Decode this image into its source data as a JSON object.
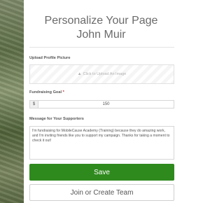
{
  "header": {
    "title_line1": "Personalize Your Page",
    "title_line2": "John Muir"
  },
  "upload": {
    "label": "Upload Profile Picture",
    "button_text": "Click to Upload An Image",
    "icon": "upload-icon"
  },
  "goal": {
    "label": "Fundraising Goal",
    "required_marker": "*",
    "currency": "$",
    "value": "150"
  },
  "message": {
    "label": "Message for Your Supporters",
    "value": "I'm fundraising for MobileCause Academy (Training) because they do amazing work, and I'm inviting friends like you to support my campaign. Thanks for taking a moment to check it out!"
  },
  "actions": {
    "save_label": "Save",
    "team_label": "Join or Create Team"
  },
  "colors": {
    "save_button": "#2f8a1e",
    "required": "#cc2222"
  }
}
